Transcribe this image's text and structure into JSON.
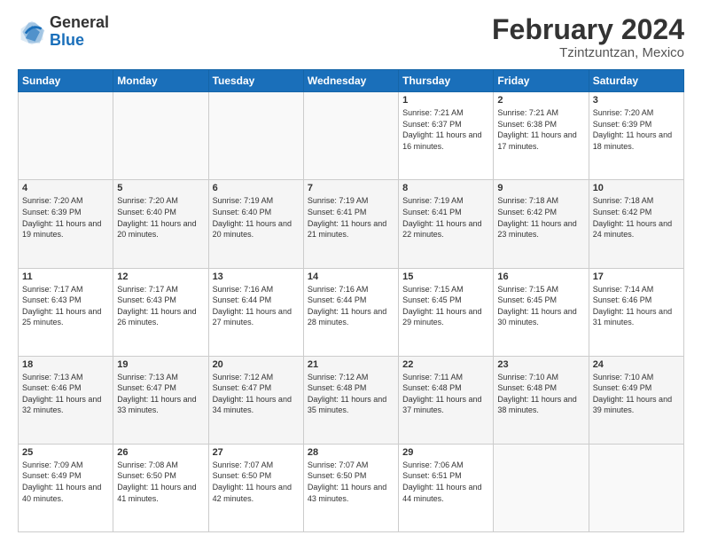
{
  "header": {
    "logo_general": "General",
    "logo_blue": "Blue",
    "main_title": "February 2024",
    "subtitle": "Tzintzuntzan, Mexico"
  },
  "calendar": {
    "days_of_week": [
      "Sunday",
      "Monday",
      "Tuesday",
      "Wednesday",
      "Thursday",
      "Friday",
      "Saturday"
    ],
    "weeks": [
      [
        {
          "day": "",
          "sunrise": "",
          "sunset": "",
          "daylight": ""
        },
        {
          "day": "",
          "sunrise": "",
          "sunset": "",
          "daylight": ""
        },
        {
          "day": "",
          "sunrise": "",
          "sunset": "",
          "daylight": ""
        },
        {
          "day": "",
          "sunrise": "",
          "sunset": "",
          "daylight": ""
        },
        {
          "day": "1",
          "sunrise": "Sunrise: 7:21 AM",
          "sunset": "Sunset: 6:37 PM",
          "daylight": "Daylight: 11 hours and 16 minutes."
        },
        {
          "day": "2",
          "sunrise": "Sunrise: 7:21 AM",
          "sunset": "Sunset: 6:38 PM",
          "daylight": "Daylight: 11 hours and 17 minutes."
        },
        {
          "day": "3",
          "sunrise": "Sunrise: 7:20 AM",
          "sunset": "Sunset: 6:39 PM",
          "daylight": "Daylight: 11 hours and 18 minutes."
        }
      ],
      [
        {
          "day": "4",
          "sunrise": "Sunrise: 7:20 AM",
          "sunset": "Sunset: 6:39 PM",
          "daylight": "Daylight: 11 hours and 19 minutes."
        },
        {
          "day": "5",
          "sunrise": "Sunrise: 7:20 AM",
          "sunset": "Sunset: 6:40 PM",
          "daylight": "Daylight: 11 hours and 20 minutes."
        },
        {
          "day": "6",
          "sunrise": "Sunrise: 7:19 AM",
          "sunset": "Sunset: 6:40 PM",
          "daylight": "Daylight: 11 hours and 20 minutes."
        },
        {
          "day": "7",
          "sunrise": "Sunrise: 7:19 AM",
          "sunset": "Sunset: 6:41 PM",
          "daylight": "Daylight: 11 hours and 21 minutes."
        },
        {
          "day": "8",
          "sunrise": "Sunrise: 7:19 AM",
          "sunset": "Sunset: 6:41 PM",
          "daylight": "Daylight: 11 hours and 22 minutes."
        },
        {
          "day": "9",
          "sunrise": "Sunrise: 7:18 AM",
          "sunset": "Sunset: 6:42 PM",
          "daylight": "Daylight: 11 hours and 23 minutes."
        },
        {
          "day": "10",
          "sunrise": "Sunrise: 7:18 AM",
          "sunset": "Sunset: 6:42 PM",
          "daylight": "Daylight: 11 hours and 24 minutes."
        }
      ],
      [
        {
          "day": "11",
          "sunrise": "Sunrise: 7:17 AM",
          "sunset": "Sunset: 6:43 PM",
          "daylight": "Daylight: 11 hours and 25 minutes."
        },
        {
          "day": "12",
          "sunrise": "Sunrise: 7:17 AM",
          "sunset": "Sunset: 6:43 PM",
          "daylight": "Daylight: 11 hours and 26 minutes."
        },
        {
          "day": "13",
          "sunrise": "Sunrise: 7:16 AM",
          "sunset": "Sunset: 6:44 PM",
          "daylight": "Daylight: 11 hours and 27 minutes."
        },
        {
          "day": "14",
          "sunrise": "Sunrise: 7:16 AM",
          "sunset": "Sunset: 6:44 PM",
          "daylight": "Daylight: 11 hours and 28 minutes."
        },
        {
          "day": "15",
          "sunrise": "Sunrise: 7:15 AM",
          "sunset": "Sunset: 6:45 PM",
          "daylight": "Daylight: 11 hours and 29 minutes."
        },
        {
          "day": "16",
          "sunrise": "Sunrise: 7:15 AM",
          "sunset": "Sunset: 6:45 PM",
          "daylight": "Daylight: 11 hours and 30 minutes."
        },
        {
          "day": "17",
          "sunrise": "Sunrise: 7:14 AM",
          "sunset": "Sunset: 6:46 PM",
          "daylight": "Daylight: 11 hours and 31 minutes."
        }
      ],
      [
        {
          "day": "18",
          "sunrise": "Sunrise: 7:13 AM",
          "sunset": "Sunset: 6:46 PM",
          "daylight": "Daylight: 11 hours and 32 minutes."
        },
        {
          "day": "19",
          "sunrise": "Sunrise: 7:13 AM",
          "sunset": "Sunset: 6:47 PM",
          "daylight": "Daylight: 11 hours and 33 minutes."
        },
        {
          "day": "20",
          "sunrise": "Sunrise: 7:12 AM",
          "sunset": "Sunset: 6:47 PM",
          "daylight": "Daylight: 11 hours and 34 minutes."
        },
        {
          "day": "21",
          "sunrise": "Sunrise: 7:12 AM",
          "sunset": "Sunset: 6:48 PM",
          "daylight": "Daylight: 11 hours and 35 minutes."
        },
        {
          "day": "22",
          "sunrise": "Sunrise: 7:11 AM",
          "sunset": "Sunset: 6:48 PM",
          "daylight": "Daylight: 11 hours and 37 minutes."
        },
        {
          "day": "23",
          "sunrise": "Sunrise: 7:10 AM",
          "sunset": "Sunset: 6:48 PM",
          "daylight": "Daylight: 11 hours and 38 minutes."
        },
        {
          "day": "24",
          "sunrise": "Sunrise: 7:10 AM",
          "sunset": "Sunset: 6:49 PM",
          "daylight": "Daylight: 11 hours and 39 minutes."
        }
      ],
      [
        {
          "day": "25",
          "sunrise": "Sunrise: 7:09 AM",
          "sunset": "Sunset: 6:49 PM",
          "daylight": "Daylight: 11 hours and 40 minutes."
        },
        {
          "day": "26",
          "sunrise": "Sunrise: 7:08 AM",
          "sunset": "Sunset: 6:50 PM",
          "daylight": "Daylight: 11 hours and 41 minutes."
        },
        {
          "day": "27",
          "sunrise": "Sunrise: 7:07 AM",
          "sunset": "Sunset: 6:50 PM",
          "daylight": "Daylight: 11 hours and 42 minutes."
        },
        {
          "day": "28",
          "sunrise": "Sunrise: 7:07 AM",
          "sunset": "Sunset: 6:50 PM",
          "daylight": "Daylight: 11 hours and 43 minutes."
        },
        {
          "day": "29",
          "sunrise": "Sunrise: 7:06 AM",
          "sunset": "Sunset: 6:51 PM",
          "daylight": "Daylight: 11 hours and 44 minutes."
        },
        {
          "day": "",
          "sunrise": "",
          "sunset": "",
          "daylight": ""
        },
        {
          "day": "",
          "sunrise": "",
          "sunset": "",
          "daylight": ""
        }
      ]
    ]
  }
}
